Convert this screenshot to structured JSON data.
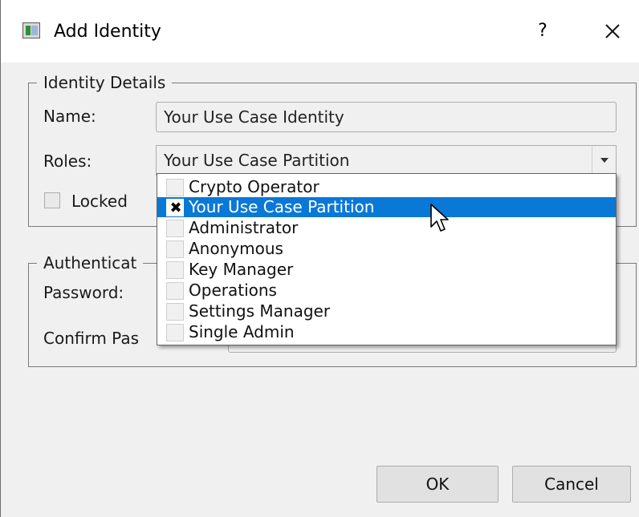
{
  "window": {
    "title": "Add Identity",
    "help_label": "?",
    "icons": {
      "app": "app-window-icon",
      "close": "close-icon",
      "help": "help-icon"
    }
  },
  "identity_details": {
    "group_title": "Identity Details",
    "name_label": "Name:",
    "name_value": "Your Use Case Identity",
    "roles_label": "Roles:",
    "roles_value": "Your Use Case Partition",
    "locked_label": "Locked",
    "locked_checked": false
  },
  "roles_dropdown": {
    "items": [
      {
        "label": "Crypto Operator",
        "checked": false,
        "highlighted": false
      },
      {
        "label": "Your Use Case Partition",
        "checked": true,
        "highlighted": true
      },
      {
        "label": "Administrator",
        "checked": false,
        "highlighted": false
      },
      {
        "label": "Anonymous",
        "checked": false,
        "highlighted": false
      },
      {
        "label": "Key Manager",
        "checked": false,
        "highlighted": false
      },
      {
        "label": "Operations",
        "checked": false,
        "highlighted": false
      },
      {
        "label": "Settings Manager",
        "checked": false,
        "highlighted": false
      },
      {
        "label": "Single Admin",
        "checked": false,
        "highlighted": false
      }
    ],
    "check_glyph": "✖"
  },
  "authentication": {
    "group_title": "Authenticat",
    "password_label": "Password:",
    "confirm_label": "Confirm Pas"
  },
  "buttons": {
    "ok": "OK",
    "cancel": "Cancel"
  },
  "colors": {
    "highlight": "#0a78d7",
    "dialog_bg": "#f0f0f0"
  }
}
